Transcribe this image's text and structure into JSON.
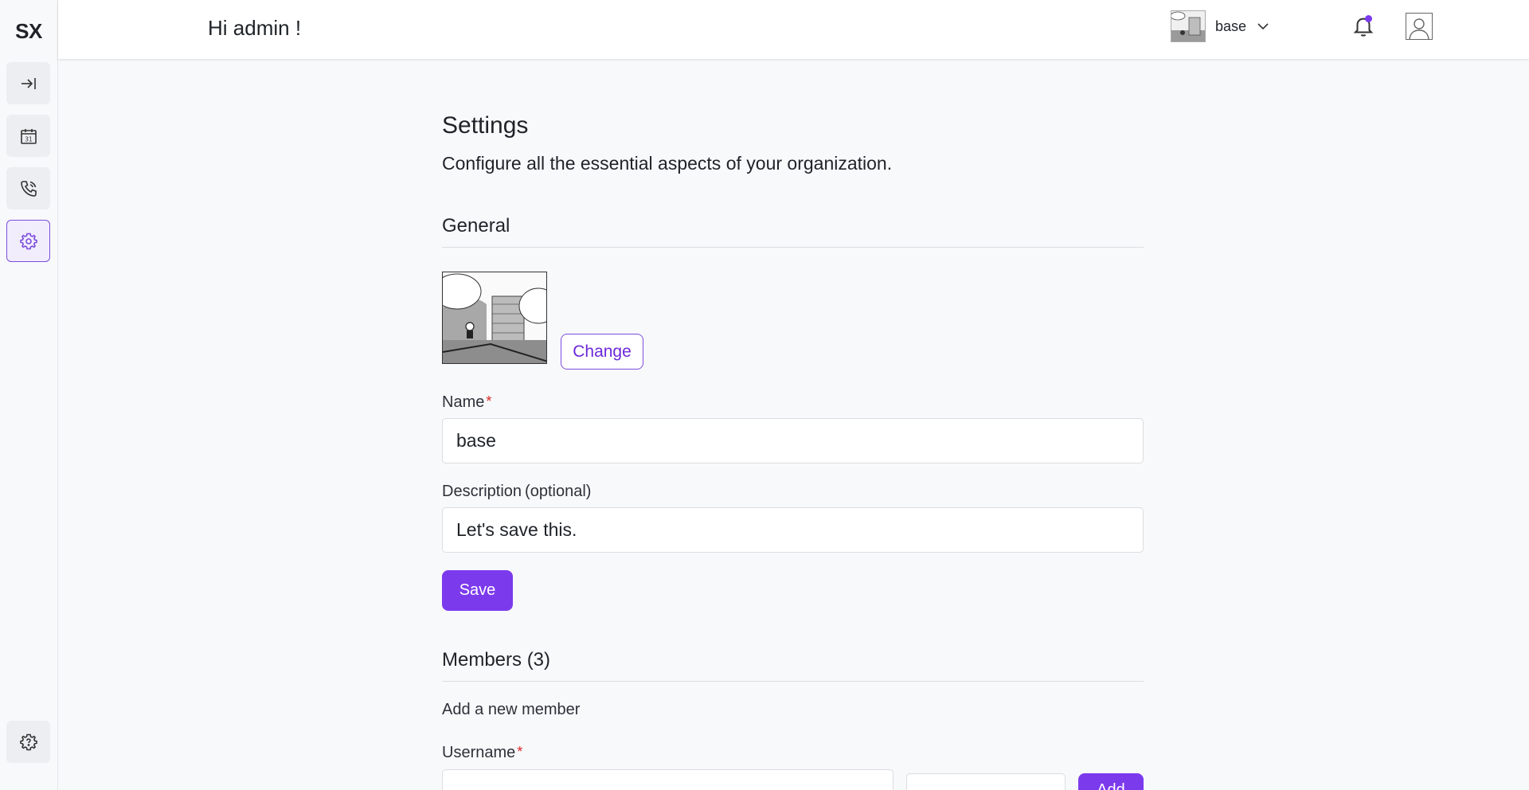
{
  "sidebar": {
    "logo": "SX",
    "items": [
      {
        "icon": "collapse-arrow-icon"
      },
      {
        "icon": "calendar-icon",
        "text": "31"
      },
      {
        "icon": "phone-icon"
      },
      {
        "icon": "gear-icon",
        "active": true
      }
    ],
    "help_icon": "help-gear-icon"
  },
  "header": {
    "greeting": "Hi admin !",
    "org_name": "base",
    "notification_dot_color": "#7c3aed"
  },
  "main": {
    "title": "Settings",
    "subtitle": "Configure all the essential aspects of your organization.",
    "general": {
      "heading": "General",
      "change_label": "Change",
      "name_label": "Name",
      "name_required": "*",
      "name_value": "base",
      "description_label": "Description",
      "description_optional": "(optional)",
      "description_value": "Let's save this.",
      "save_label": "Save"
    },
    "members": {
      "heading": "Members (3)",
      "add_new_label": "Add a new member",
      "username_label": "Username",
      "username_required": "*",
      "add_label": "Add"
    }
  },
  "colors": {
    "accent": "#7c3aed",
    "required": "#dc2626"
  }
}
